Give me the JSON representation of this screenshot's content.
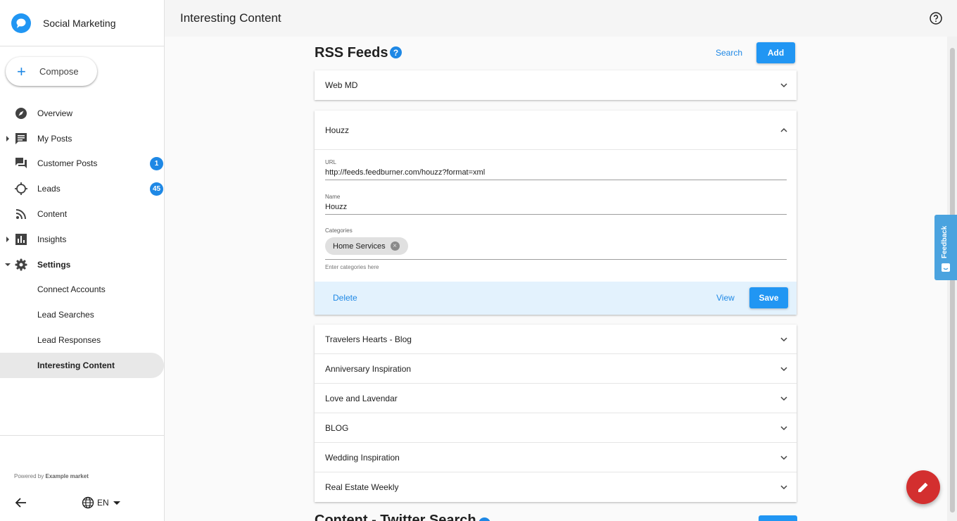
{
  "app": {
    "name": "Social Marketing"
  },
  "compose": {
    "label": "Compose"
  },
  "nav": {
    "items": [
      {
        "label": "Overview"
      },
      {
        "label": "My Posts"
      },
      {
        "label": "Customer Posts",
        "badge": "1"
      },
      {
        "label": "Leads",
        "badge": "45"
      },
      {
        "label": "Content"
      },
      {
        "label": "Insights"
      },
      {
        "label": "Settings"
      },
      {
        "label": "Connect Accounts"
      },
      {
        "label": "Lead Searches"
      },
      {
        "label": "Lead Responses"
      },
      {
        "label": "Interesting Content"
      }
    ]
  },
  "footer": {
    "powered_prefix": "Powered by",
    "powered_brand": "Example market",
    "language": "EN"
  },
  "header": {
    "title": "Interesting Content"
  },
  "rss": {
    "title": "RSS Feeds",
    "help": "?",
    "search_label": "Search",
    "add_label": "Add",
    "feeds_top": [
      "Web MD"
    ],
    "expanded": {
      "name": "Houzz",
      "url_label": "URL",
      "url_value": "http://feeds.feedburner.com/houzz?format=xml",
      "name_label": "Name",
      "name_value": "Houzz",
      "categories_label": "Categories",
      "chip": "Home Services",
      "chip_remove": "×",
      "categories_hint": "Enter categories here",
      "delete_label": "Delete",
      "view_label": "View",
      "save_label": "Save"
    },
    "feeds_bottom": [
      "Travelers Hearts - Blog",
      "Anniversary Inspiration",
      "Love and Lavendar",
      "BLOG",
      "Wedding Inspiration",
      "Real Estate Weekly"
    ]
  },
  "next_section": {
    "title": "Content - Twitter Search"
  },
  "feedback": {
    "label": "Feedback"
  },
  "colors": {
    "accent": "#2196f3",
    "fab": "#d32f2f",
    "feedback": "#4aa3df",
    "action_bar": "#e3f2fd"
  }
}
